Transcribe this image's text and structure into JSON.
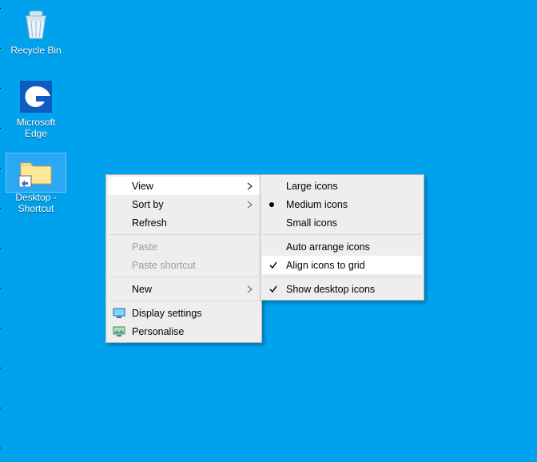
{
  "desktop_icons": {
    "recycle_bin": "Recycle Bin",
    "edge": "Microsoft Edge",
    "desktop_shortcut_line1": "Desktop -",
    "desktop_shortcut_line2": "Shortcut"
  },
  "context_menu": {
    "view": "View",
    "sort_by": "Sort by",
    "refresh": "Refresh",
    "paste": "Paste",
    "paste_shortcut": "Paste shortcut",
    "new": "New",
    "display_settings": "Display settings",
    "personalise": "Personalise"
  },
  "view_submenu": {
    "large_icons": "Large icons",
    "medium_icons": "Medium icons",
    "small_icons": "Small icons",
    "auto_arrange": "Auto arrange icons",
    "align_to_grid": "Align icons to grid",
    "show_icons": "Show desktop icons"
  }
}
